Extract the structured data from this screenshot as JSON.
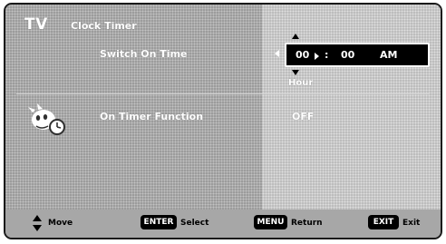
{
  "header": {
    "tv_label": "TV",
    "menu_title": "Clock Timer"
  },
  "items": {
    "switch_on_time": {
      "label": "Switch On Time",
      "hour": "00",
      "separator": ":",
      "minute": "00",
      "ampm": "AM",
      "field_label": "Hour"
    },
    "on_timer_function": {
      "label": "On Timer Function",
      "value": "OFF"
    }
  },
  "footer": {
    "move_label": "Move",
    "enter_key": "ENTER",
    "enter_label": "Select",
    "menu_key": "MENU",
    "menu_label": "Return",
    "exit_key": "EXIT",
    "exit_label": "Exit"
  },
  "icons": [
    "tv-mascot-icon",
    "up-down-arrow-icon",
    "chevron-up-icon",
    "chevron-down-icon",
    "chevron-left-icon",
    "chevron-right-icon"
  ],
  "colors": {
    "menu_background": "#9c9c9c",
    "value_panel": "#bdbdbd",
    "selection_box": "#000000",
    "text": "#ffffff"
  }
}
